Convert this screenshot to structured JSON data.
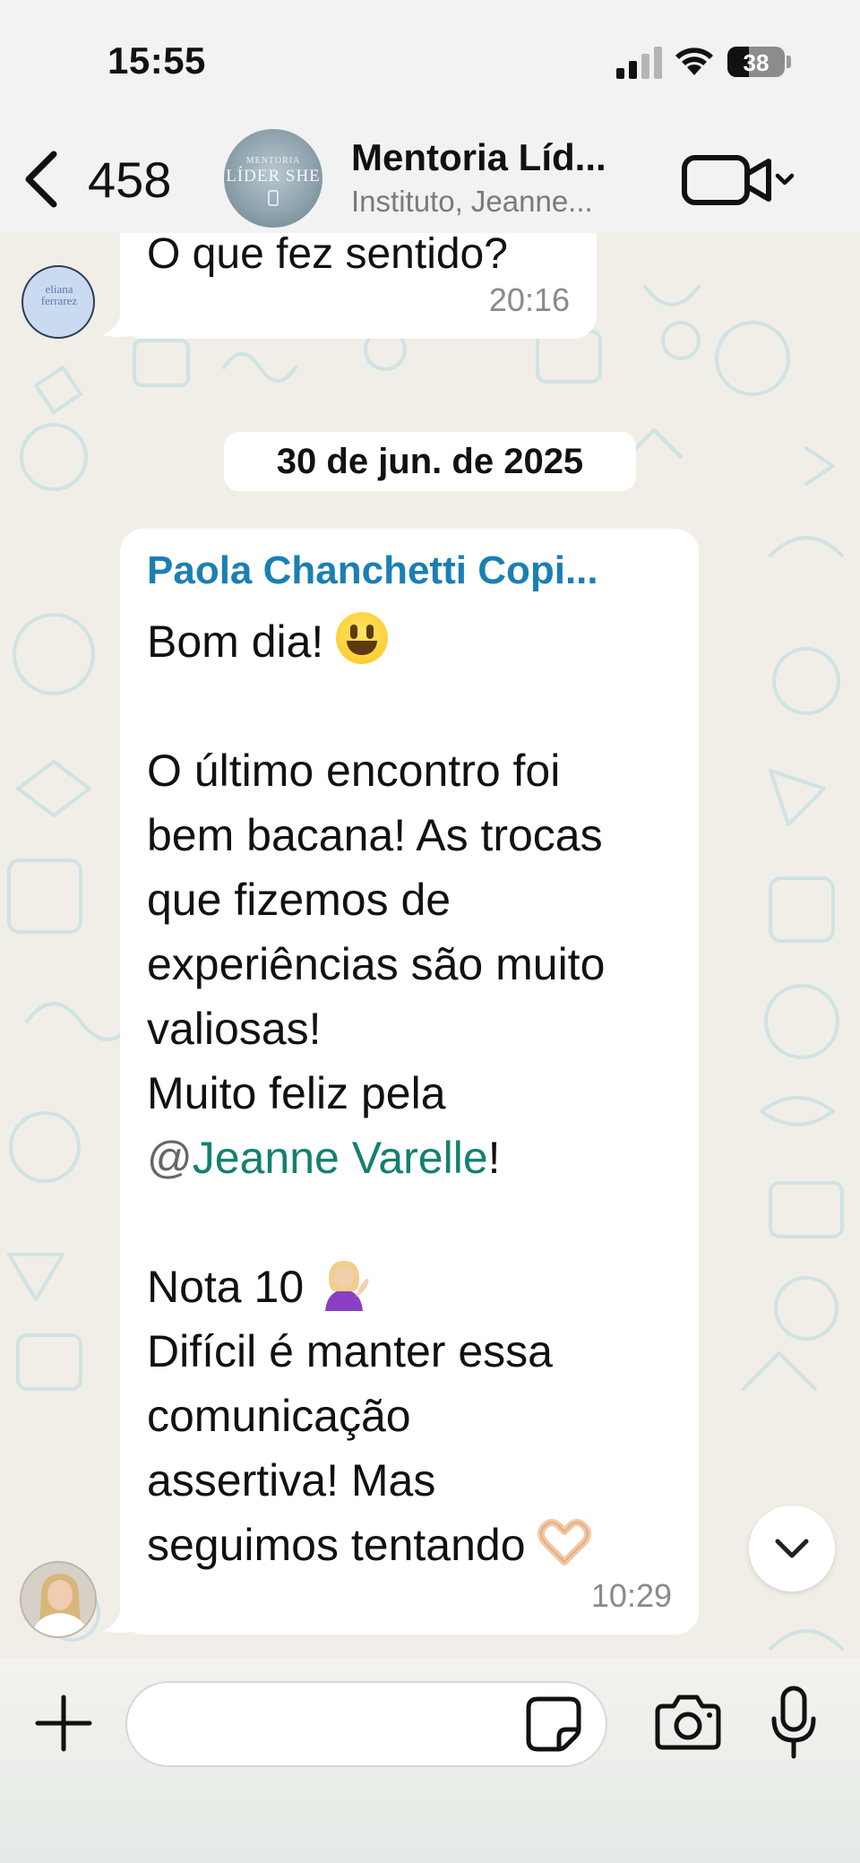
{
  "status_bar": {
    "time": "15:55",
    "battery_level": "38"
  },
  "header": {
    "back_count": "458",
    "avatar_text_top": "MENTORIA",
    "avatar_text_main": "LÍDER SHE",
    "title": "Mentoria Líd...",
    "subtitle": "Instituto, Jeanne..."
  },
  "messages": [
    {
      "text": "O que fez sentido?",
      "time": "20:16",
      "avatar_logo": "eliana ferrarez"
    },
    {
      "date_separator": "30 de jun. de 2025",
      "sender": "Paola Chanchetti Copi...",
      "lines": {
        "l1": "Bom dia! ",
        "l3": "O último encontro foi",
        "l4": "bem bacana! As trocas",
        "l5": "que fizemos de",
        "l6": "experiências são muito",
        "l7": "valiosas!",
        "l8": "Muito feliz pela",
        "mention_at": "@",
        "mention_name": "Jeanne Varelle",
        "mention_suffix": "!",
        "l11": "Nota 10 ",
        "l12": "Difícil é manter essa",
        "l13": "comunicação",
        "l14": "assertiva! Mas",
        "l15": "seguimos tentando "
      },
      "time": "10:29"
    }
  ],
  "input": {
    "placeholder": ""
  },
  "colors": {
    "sender_name": "#1b7fb3",
    "mention": "#13806f",
    "wallpaper_doodle": "#cfe3e3"
  },
  "icons": [
    "back-chevron-icon",
    "video-call-icon",
    "chevron-down-icon",
    "plus-icon",
    "sticker-icon",
    "camera-icon",
    "microphone-icon",
    "signal-icon",
    "wifi-icon",
    "battery-icon"
  ]
}
